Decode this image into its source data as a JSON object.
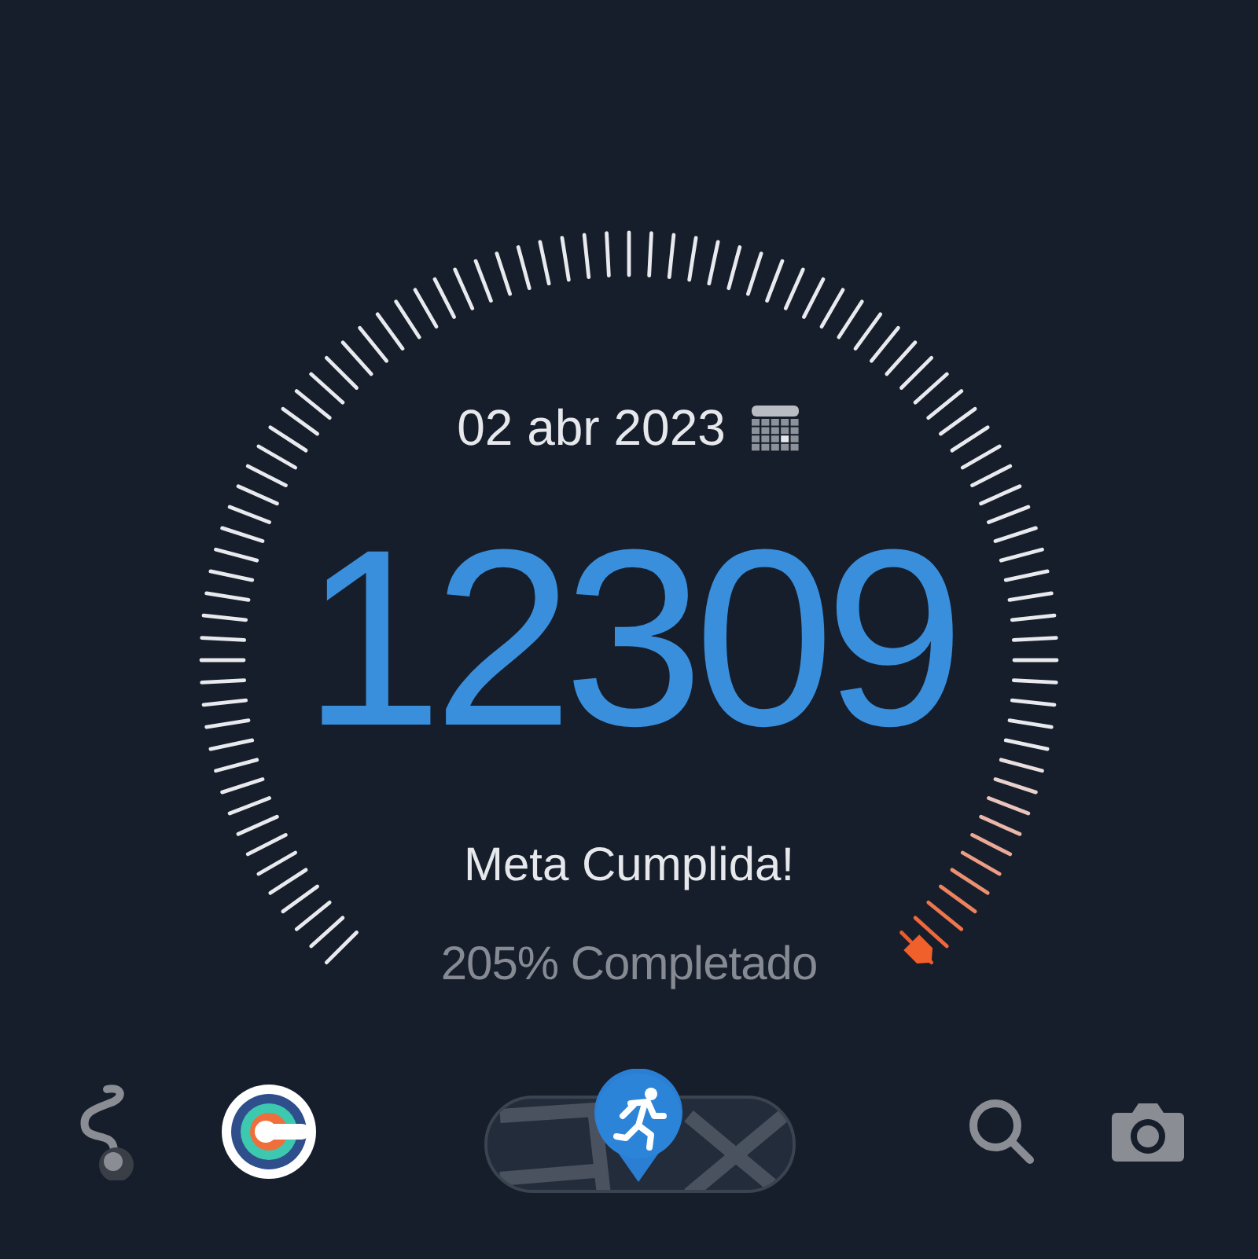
{
  "date": "02 abr 2023",
  "steps": "12309",
  "goal_message": "Meta Cumplida!",
  "completion": "205% Completado",
  "bottom_bar": [
    {
      "kind": "route"
    },
    {
      "kind": "app-logo"
    },
    {
      "kind": "map"
    },
    {
      "kind": "search"
    },
    {
      "kind": "camera"
    }
  ]
}
